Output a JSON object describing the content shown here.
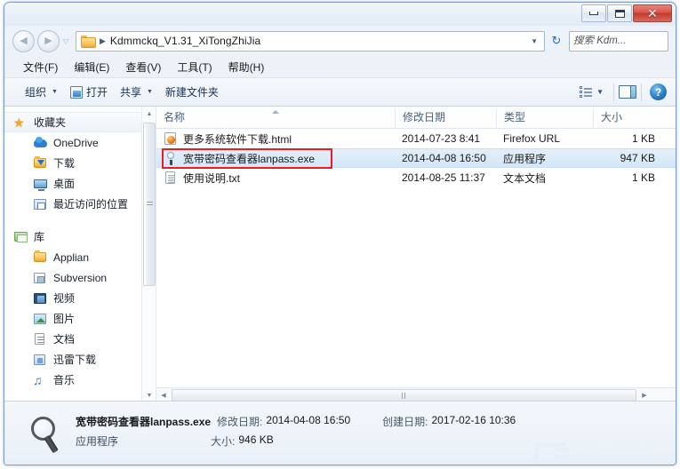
{
  "window": {
    "controls": {
      "minimize": "minimize-icon",
      "maximize": "maximize-icon",
      "close": "✕"
    }
  },
  "address_bar": {
    "back_glyph": "◀",
    "forward_glyph": "▶",
    "history_glyph": "▽",
    "folder_icon": "folder-icon",
    "separator": "▶",
    "path": "Kdmmckq_V1.31_XiTongZhiJia",
    "chevron": "▼",
    "refresh_glyph": "↻"
  },
  "search": {
    "placeholder": "搜索 Kdm...",
    "value": "",
    "icon": "search-icon"
  },
  "menu": {
    "items": [
      {
        "label": "文件(F)"
      },
      {
        "label": "编辑(E)"
      },
      {
        "label": "查看(V)"
      },
      {
        "label": "工具(T)"
      },
      {
        "label": "帮助(H)"
      }
    ]
  },
  "toolbar": {
    "organize": "组织",
    "organize_caret": "▼",
    "open": "打开",
    "share": "共享",
    "share_caret": "▼",
    "new_folder": "新建文件夹",
    "view_caret": "▼",
    "help_glyph": "?"
  },
  "sidebar": {
    "items": [
      {
        "label": "收藏夹",
        "icon": "star-icon",
        "level": "root",
        "selected": true
      },
      {
        "label": "OneDrive",
        "icon": "onedrive-icon",
        "level": "child",
        "selected": false
      },
      {
        "label": "下载",
        "icon": "downloads-folder-icon",
        "level": "child",
        "selected": false
      },
      {
        "label": "桌面",
        "icon": "desktop-icon",
        "level": "child",
        "selected": false
      },
      {
        "label": "最近访问的位置",
        "icon": "recent-places-icon",
        "level": "child",
        "selected": false
      },
      {
        "label": "库",
        "icon": "library-icon",
        "level": "root",
        "selected": false
      },
      {
        "label": "Applian",
        "icon": "folder-icon",
        "level": "child",
        "selected": false
      },
      {
        "label": "Subversion",
        "icon": "subversion-icon",
        "level": "child",
        "selected": false
      },
      {
        "label": "视频",
        "icon": "video-library-icon",
        "level": "child",
        "selected": false
      },
      {
        "label": "图片",
        "icon": "pictures-library-icon",
        "level": "child",
        "selected": false
      },
      {
        "label": "文档",
        "icon": "documents-library-icon",
        "level": "child",
        "selected": false
      },
      {
        "label": "迅雷下载",
        "icon": "thunder-download-icon",
        "level": "child",
        "selected": false
      },
      {
        "label": "音乐",
        "icon": "music-library-icon",
        "level": "child",
        "selected": false
      }
    ],
    "scroll_up_glyph": "▲",
    "scroll_down_glyph": "▼"
  },
  "file_list": {
    "columns": [
      {
        "label": "名称",
        "sorted": "asc"
      },
      {
        "label": "修改日期",
        "sorted": ""
      },
      {
        "label": "类型",
        "sorted": ""
      },
      {
        "label": "大小",
        "sorted": ""
      }
    ],
    "rows": [
      {
        "name": "更多系统软件下载.html",
        "date": "2014-07-23 8:41",
        "type": "Firefox URL",
        "size": "1 KB",
        "icon": "html-file-icon",
        "selected": false,
        "highlighted": false
      },
      {
        "name": "宽带密码查看器lanpass.exe",
        "date": "2014-04-08 16:50",
        "type": "应用程序",
        "size": "947 KB",
        "icon": "exe-file-icon",
        "selected": true,
        "highlighted": true
      },
      {
        "name": "使用说明.txt",
        "date": "2014-08-25 11:37",
        "type": "文本文档",
        "size": "1 KB",
        "icon": "txt-file-icon",
        "selected": false,
        "highlighted": false
      }
    ],
    "scroll_left_glyph": "◀",
    "scroll_right_glyph": "▶"
  },
  "details_pane": {
    "icon": "magnifier-icon",
    "file_name": "宽带密码查看器lanpass.exe",
    "modified_label": "修改日期:",
    "modified_value": "2014-04-08 16:50",
    "created_label": "创建日期:",
    "created_value": "2017-02-16 10:36",
    "file_type": "应用程序",
    "size_label": "大小:",
    "size_value": "946 KB"
  },
  "watermark": {
    "text": "系统之家",
    "subtext": "XITONGZHIJIA.NET"
  },
  "colors": {
    "highlight_box": "#ec1c24",
    "selection": "#d3e7f7",
    "close_button": "#c03a2c"
  }
}
